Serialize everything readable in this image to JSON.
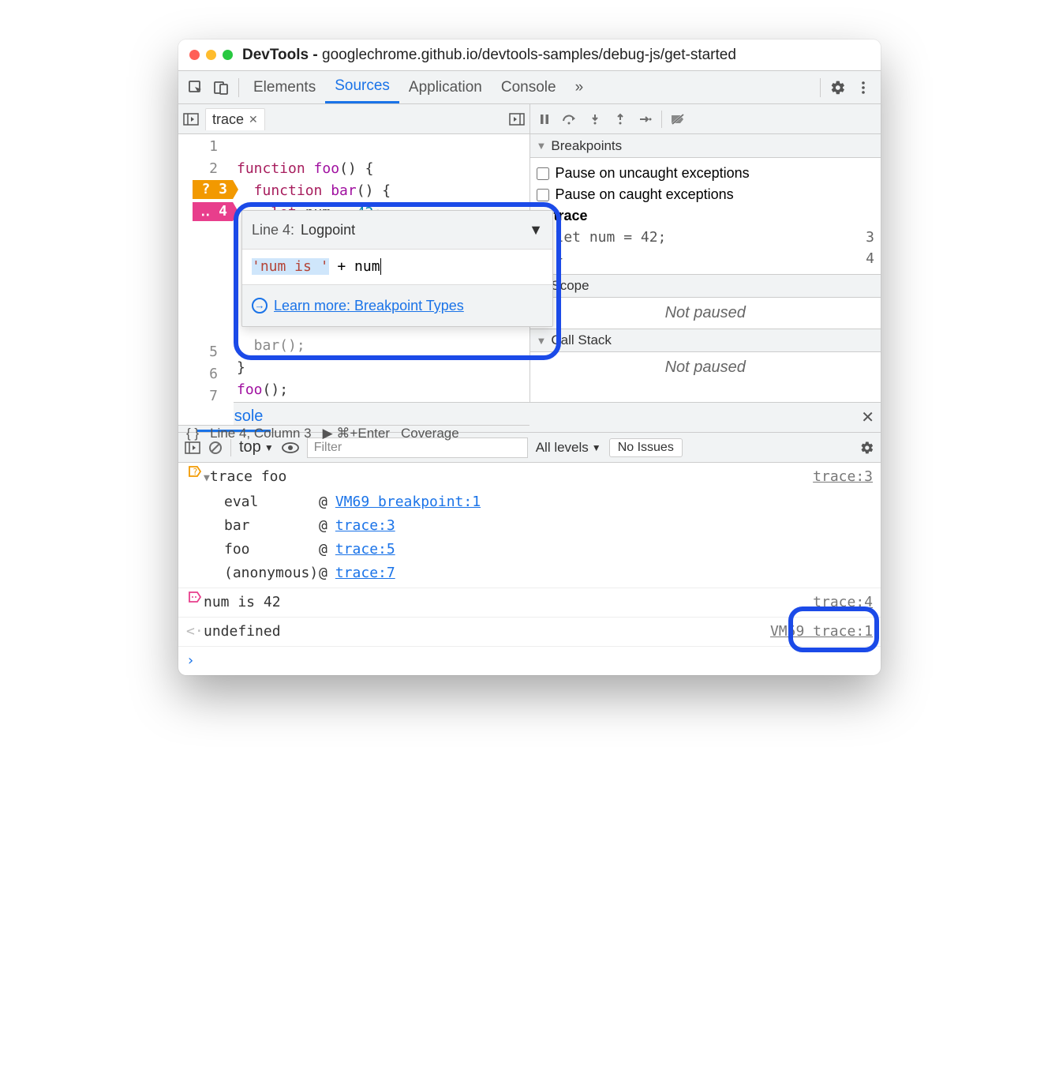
{
  "title_prefix": "DevTools - ",
  "title_url": "googlechrome.github.io/devtools-samples/debug-js/get-started",
  "panels": [
    "Elements",
    "Sources",
    "Application",
    "Console"
  ],
  "active_panel": "Sources",
  "more_glyph": "»",
  "file_tab": "trace",
  "code_lines": {
    "l1a": "function",
    "l1b": " foo",
    "l1c": "() {",
    "l2a": "  function",
    "l2b": " bar",
    "l2c": "() {",
    "l3a": "    let",
    "l3b": " num = ",
    "l3c": "42",
    "l3d": ";",
    "l4": "  }",
    "l5": "  bar();",
    "l6": "}",
    "l7": "foo",
    "l7b": "();"
  },
  "line_numbers": [
    "1",
    "2",
    "3",
    "4",
    "5",
    "6",
    "7"
  ],
  "bp_line3_marker": "?  3",
  "bp_line4_marker": "‥  4",
  "logpoint": {
    "line_label": "Line 4:",
    "type": "Logpoint",
    "input_str": "'num is '",
    "input_rest": " + num",
    "learn_more": "Learn more: Breakpoint Types"
  },
  "editor_status": {
    "pretty": "{ }",
    "cursor": "Line 4, Column 3",
    "run": "▶ ⌘+Enter",
    "coverage": "Coverage"
  },
  "debug": {
    "breakpoints_head": "Breakpoints",
    "pause_uncaught": "Pause on uncaught exceptions",
    "pause_caught": "Pause on caught exceptions",
    "group": "trace",
    "bp1_code": "let num = 42;",
    "bp1_line": "3",
    "bp2_code": "}",
    "bp2_line": "4",
    "scope_head": "Scope",
    "not_paused": "Not paused",
    "callstack_head": "Call Stack"
  },
  "console": {
    "tab": "Console",
    "context": "top",
    "filter_placeholder": "Filter",
    "levels": "All levels",
    "issues": "No Issues",
    "row1_text": "trace foo",
    "row1_src": "trace:3",
    "stack": [
      {
        "fn": "eval",
        "at": "@",
        "link": "VM69 breakpoint:1"
      },
      {
        "fn": "bar",
        "at": "@",
        "link": "trace:3"
      },
      {
        "fn": "foo",
        "at": "@",
        "link": "trace:5"
      },
      {
        "fn": "(anonymous)",
        "at": "@",
        "link": "trace:7"
      }
    ],
    "row2_text": "num is 42",
    "row2_src": "trace:4",
    "row3_text": "undefined",
    "row3_src": "VM59 trace:1",
    "prompt": "›"
  }
}
